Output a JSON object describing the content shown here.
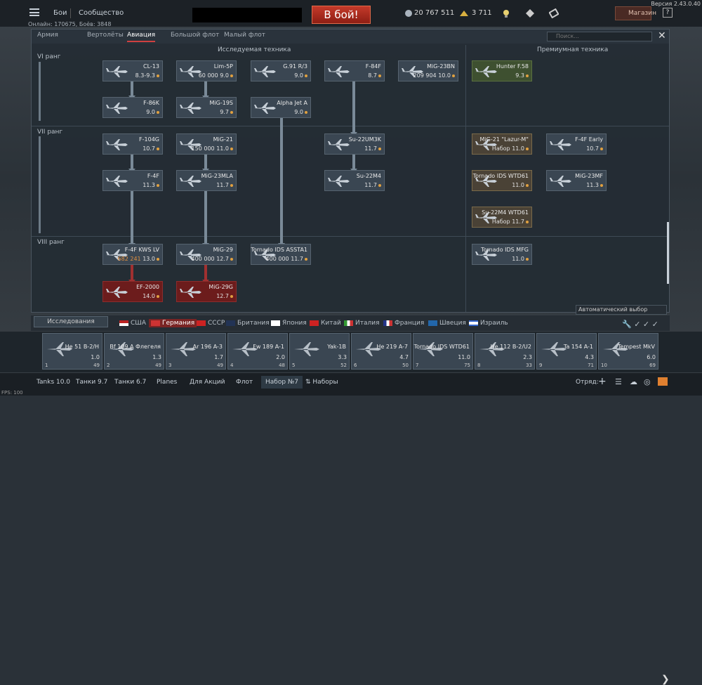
{
  "app": {
    "version": "Версия 2.43.0.40",
    "online": "Онлайн: 170675, Боёв: 3848",
    "fps": "FPS: 100"
  },
  "topnav": {
    "battles": "Бои",
    "community": "Сообщество",
    "battle_button": "В бой!",
    "silver": "20 767 511",
    "gold": "3 711",
    "shop": "Магазин",
    "help": "?"
  },
  "tabs": [
    {
      "label": "Армия"
    },
    {
      "label": "Вертолёты"
    },
    {
      "label": "Авиация"
    },
    {
      "label": "Большой флот"
    },
    {
      "label": "Малый флот"
    }
  ],
  "search_placeholder": "Поиск...",
  "columns": {
    "researched": "Исследуемая техника",
    "premium": "Премиумная техника"
  },
  "ranks": {
    "r6": "VI ранг",
    "r7": "VII ранг",
    "r8": "VIII ранг"
  },
  "cards": [
    {
      "name": "CL-13",
      "br": "8.3-9.3"
    },
    {
      "name": "Lim-5P",
      "br": "9.0",
      "cost": "60 000"
    },
    {
      "name": "G.91 R/3",
      "br": "9.0"
    },
    {
      "name": "F-84F",
      "br": "8.7"
    },
    {
      "name": "MiG-23BN",
      "br": "10.0",
      "cost": "209 904"
    },
    {
      "name": "Hunter F.58",
      "br": "9.3"
    },
    {
      "name": "F-86K",
      "br": "9.0"
    },
    {
      "name": "MiG-19S",
      "br": "9.7"
    },
    {
      "name": "Alpha Jet A",
      "br": "9.0"
    },
    {
      "name": "F-104G",
      "br": "10.7"
    },
    {
      "name": "MiG-21",
      "br": "11.0",
      "cost": "150 000"
    },
    {
      "name": "Su-22UM3K",
      "br": "11.7"
    },
    {
      "name": "MiG-21 \"Lazur-M\"",
      "br": "11.0",
      "set": "Набор"
    },
    {
      "name": "F-4F Early",
      "br": "10.7"
    },
    {
      "name": "F-4F",
      "br": "11.3"
    },
    {
      "name": "MiG-23MLA",
      "br": "11.7"
    },
    {
      "name": "Su-22M4",
      "br": "11.7"
    },
    {
      "name": "Tornado IDS WTD61",
      "br": "11.0"
    },
    {
      "name": "MiG-23MF",
      "br": "11.3"
    },
    {
      "name": "Su-22M4 WTD61",
      "br": "11.7",
      "set": "Набор"
    },
    {
      "name": "F-4F KWS LV",
      "br": "13.0",
      "cost": "682 241"
    },
    {
      "name": "MiG-29",
      "br": "12.7",
      "cost": "400 000"
    },
    {
      "name": "Tornado IDS ASSTA1",
      "br": "11.7",
      "cost": "400 000"
    },
    {
      "name": "Tornado IDS MFG",
      "br": "11.0"
    },
    {
      "name": "EF-2000",
      "br": "14.0"
    },
    {
      "name": "MiG-29G",
      "br": "12.7"
    }
  ],
  "countries": [
    {
      "label": "США"
    },
    {
      "label": "Германия"
    },
    {
      "label": "СССР"
    },
    {
      "label": "Британия"
    },
    {
      "label": "Япония"
    },
    {
      "label": "Китай"
    },
    {
      "label": "Италия"
    },
    {
      "label": "Франция"
    },
    {
      "label": "Швеция"
    },
    {
      "label": "Израиль"
    }
  ],
  "research_button": "Исследования",
  "auto_select": "Автоматический выбор",
  "lineup": [
    {
      "name": "He 51 B-2/H",
      "br": "1.0",
      "num": "1",
      "res": "49"
    },
    {
      "name": "Bf 109 A Флегеля",
      "br": "1.3",
      "num": "2",
      "res": "49"
    },
    {
      "name": "Ar 196 A-3",
      "br": "1.7",
      "num": "3",
      "res": "49"
    },
    {
      "name": "Fw 189 A-1",
      "br": "2.0",
      "num": "4",
      "res": "48"
    },
    {
      "name": "Yak-1B",
      "br": "3.3",
      "num": "5",
      "res": "52"
    },
    {
      "name": "He 219 A-7",
      "br": "4.7",
      "num": "6",
      "res": "50"
    },
    {
      "name": "Tornado IDS WTD61",
      "br": "11.0",
      "num": "7",
      "res": "75"
    },
    {
      "name": "He 112 B-2/U2",
      "br": "2.3",
      "num": "8",
      "res": "33"
    },
    {
      "name": "Ta 154 A-1",
      "br": "4.3",
      "num": "9",
      "res": "71"
    },
    {
      "name": "Tempest MkV",
      "br": "6.0",
      "num": "10",
      "res": "69"
    }
  ],
  "bottom_tabs": [
    {
      "label": "Tanks 10.0"
    },
    {
      "label": "Танки 9.7"
    },
    {
      "label": "Танки 6.7"
    },
    {
      "label": "Planes"
    },
    {
      "label": "Для Акций"
    },
    {
      "label": "Флот"
    },
    {
      "label": "Набор №7"
    },
    {
      "label": "Наборы"
    }
  ],
  "squad": "Отряд:"
}
